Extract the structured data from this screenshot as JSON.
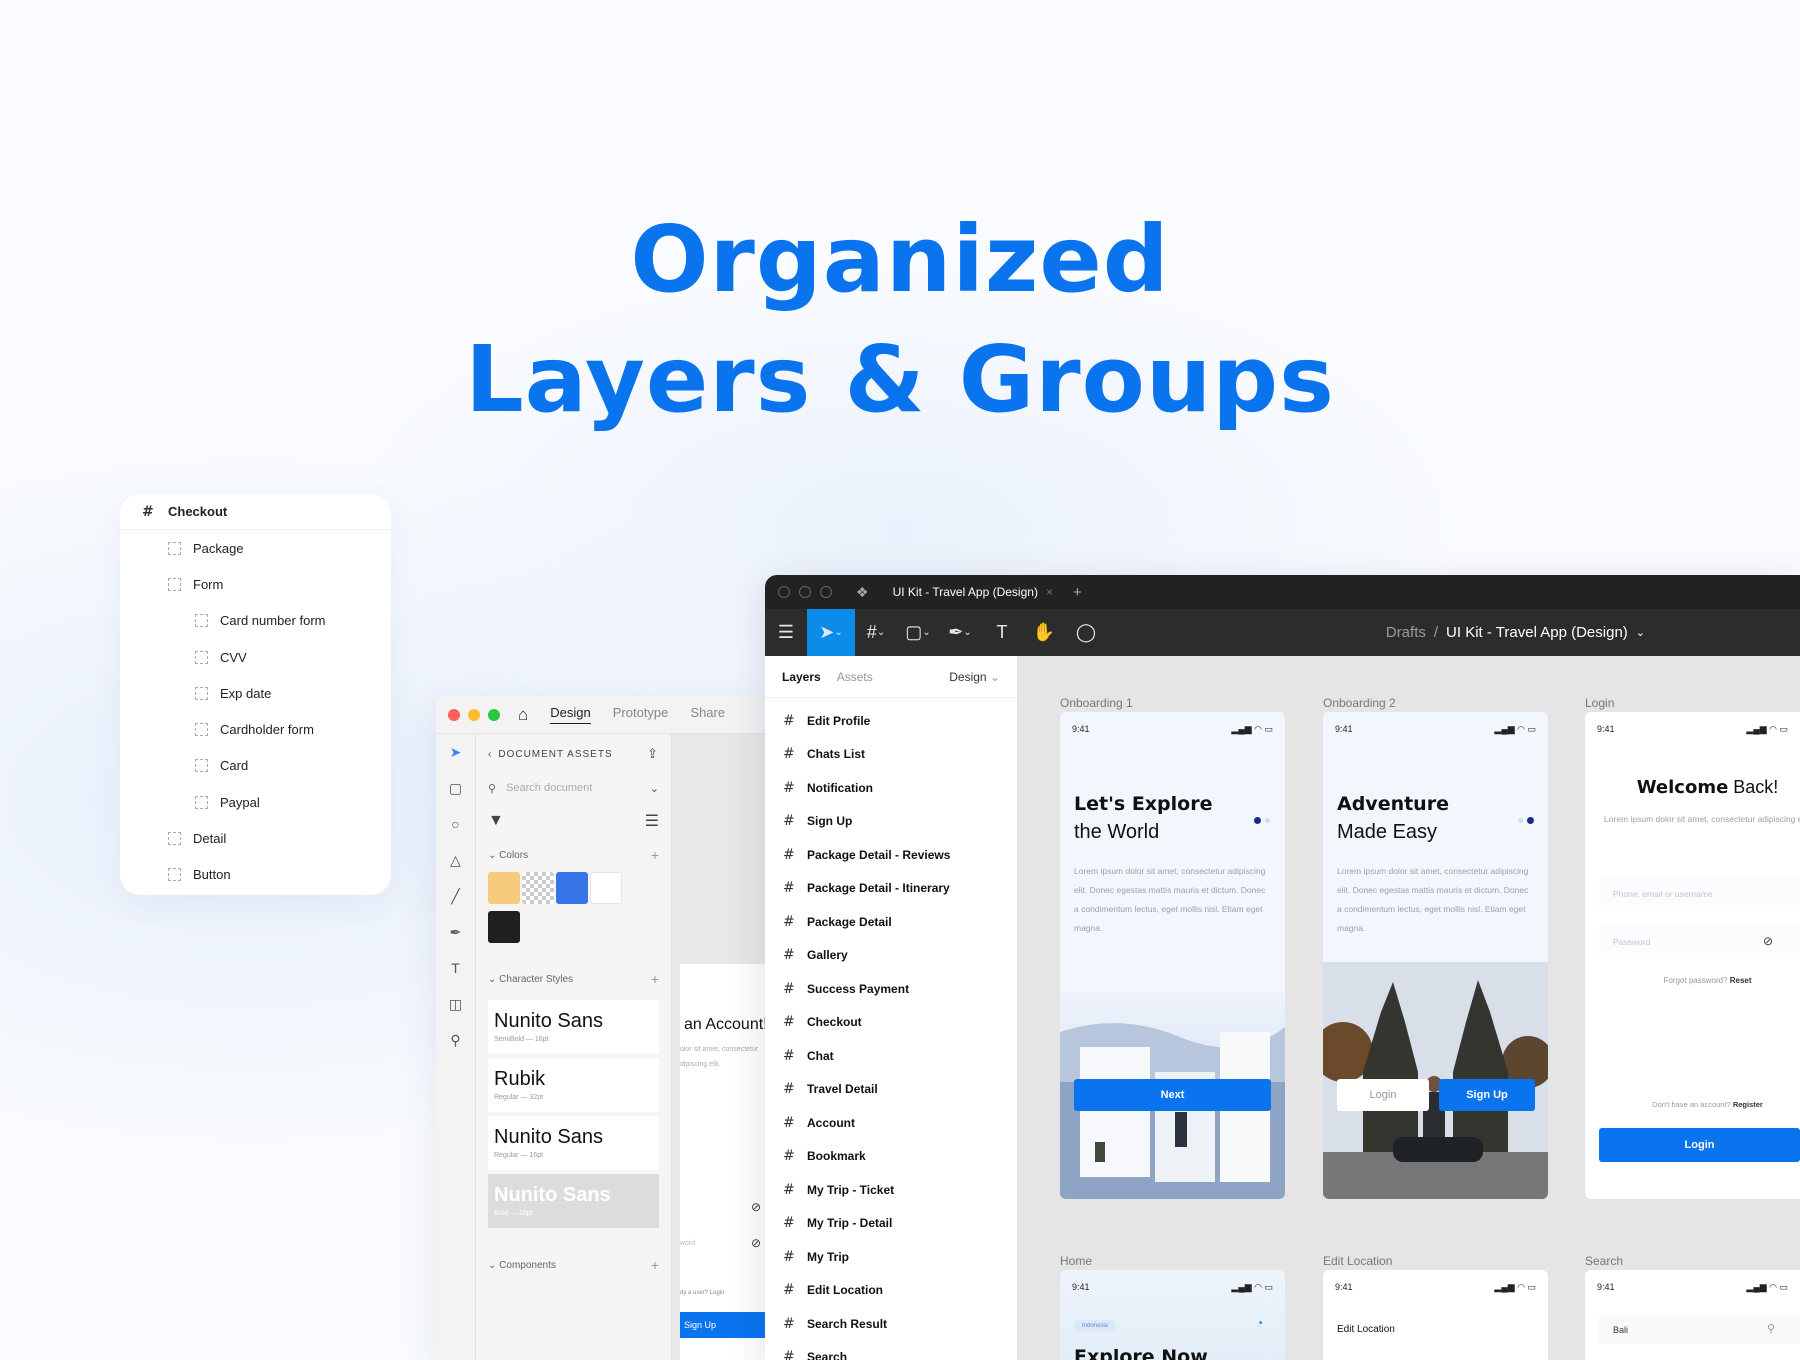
{
  "hero": {
    "line1": "Organized",
    "line2": "Layers & Groups"
  },
  "layer_card": {
    "root": "Checkout",
    "items": [
      {
        "label": "Package",
        "level": 1
      },
      {
        "label": "Form",
        "level": 1
      },
      {
        "label": "Card number form",
        "level": 2
      },
      {
        "label": "CVV",
        "level": 2
      },
      {
        "label": "Exp date",
        "level": 2
      },
      {
        "label": "Cardholder form",
        "level": 2
      },
      {
        "label": "Card",
        "level": 2
      },
      {
        "label": "Paypal",
        "level": 2
      },
      {
        "label": "Detail",
        "level": 1
      },
      {
        "label": "Button",
        "level": 1
      }
    ]
  },
  "assets_window": {
    "tabs": [
      "Design",
      "Prototype",
      "Share"
    ],
    "section_title": "DOCUMENT ASSETS",
    "search_placeholder": "Search document",
    "colors_label": "Colors",
    "colors": [
      "#f6cb7c",
      "checker",
      "#3774e8",
      "#ffffff",
      "#1f1f1f"
    ],
    "char_styles_label": "Character Styles",
    "styles": [
      {
        "name": "Nunito Sans",
        "sub": "SemiBold — 16pt"
      },
      {
        "name": "Rubik",
        "sub": "Regular — 32pt"
      },
      {
        "name": "Nunito Sans",
        "sub": "Regular — 16pt"
      },
      {
        "name": "Nunito Sans",
        "sub": "Bold — 18pt"
      }
    ],
    "components_label": "Components",
    "peek": {
      "title": "an Account!",
      "text1": "olor sit amet, consectetur",
      "text2": "dipiscing elit.",
      "link": "dy a user? Login",
      "button": "Sign Up",
      "placeholder": "word"
    }
  },
  "main_window": {
    "tab_title": "UI Kit - Travel App (Design)",
    "breadcrumb_root": "Drafts",
    "breadcrumb_sep": "/",
    "breadcrumb_file": "UI Kit - Travel App (Design)",
    "panel_tabs": {
      "layers": "Layers",
      "assets": "Assets",
      "design": "Design"
    },
    "frames": [
      "Edit Profile",
      "Chats List",
      "Notification",
      "Sign Up",
      "Package Detail - Reviews",
      "Package Detail - Itinerary",
      "Package Detail",
      "Gallery",
      "Success Payment",
      "Checkout",
      "Chat",
      "Travel Detail",
      "Account",
      "Bookmark",
      "My Trip - Ticket",
      "My Trip - Detail",
      "My Trip",
      "Edit Location",
      "Search Result",
      "Search"
    ],
    "screens": {
      "onb1": {
        "label": "Onboarding 1",
        "time": "9:41",
        "title_bold": "Let's Explore",
        "title_rest": "the World",
        "body": "Lorem ipsum dolor sit amet, consectetur adipiscing elit. Donec egestas mattis mauris et dictum. Donec a condimentum lectus, eget mollis nisl. Etiam eget magna.",
        "button": "Next"
      },
      "onb2": {
        "label": "Onboarding 2",
        "time": "9:41",
        "title_bold": "Adventure",
        "title_rest": "Made Easy",
        "body": "Lorem ipsum dolor sit amet, consectetur adipiscing elit. Donec egestas mattis mauris et dictum. Donec a condimentum lectus, eget mollis nisl. Etiam eget magna.",
        "login": "Login",
        "signup": "Sign Up"
      },
      "login": {
        "label": "Login",
        "time": "9:41",
        "title_bold": "Welcome",
        "title_rest": " Back!",
        "body": "Lorem ipsum dolor sit amet, consectetur adipiscing elit.",
        "field1": "Phone, email or username",
        "field2": "Password",
        "forgot": "Forgot password?",
        "reset": "Reset",
        "no_account": "Don't have an account?",
        "register": "Register",
        "button": "Login"
      },
      "home": {
        "label": "Home",
        "time": "9:41",
        "chip": "Indonesia",
        "heading": "Explore Now"
      },
      "edit_location": {
        "label": "Edit Location",
        "time": "9:41",
        "heading": "Edit Location"
      },
      "search": {
        "label": "Search",
        "time": "9:41",
        "value": "Bali"
      }
    }
  },
  "accent": "#0a74ef"
}
